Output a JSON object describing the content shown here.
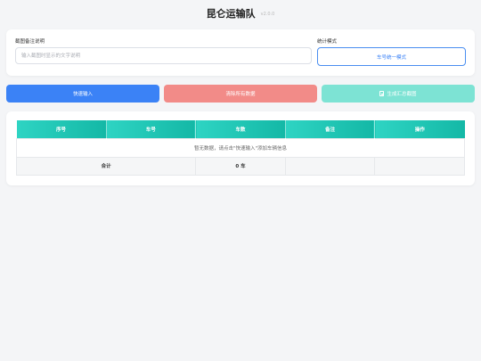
{
  "header": {
    "title": "昆仑运输队",
    "version": "v2.0.0"
  },
  "form": {
    "note_label": "截图备注说明",
    "note_placeholder": "输入截图时显示的文字说明",
    "note_value": "",
    "mode_label": "统计模式",
    "mode_button": "车号统一模式"
  },
  "actions": {
    "quick_input": "快速输入",
    "clear_all": "清除所有数据",
    "generate_summary": "生成汇总截图"
  },
  "table": {
    "columns": [
      "序号",
      "车号",
      "车数",
      "备注",
      "操作"
    ],
    "empty_text": "暂无数据，请点击\"快速输入\"添加车辆信息",
    "total_label": "合计",
    "total_count": "0 车"
  },
  "colors": {
    "primary": "#3b82f6",
    "danger": "#f28b88",
    "teal": "#7de3d4",
    "header_gradient_start": "#2ed4c3",
    "header_gradient_end": "#14b8a6"
  },
  "icons": {
    "generate_summary": "document-icon"
  }
}
